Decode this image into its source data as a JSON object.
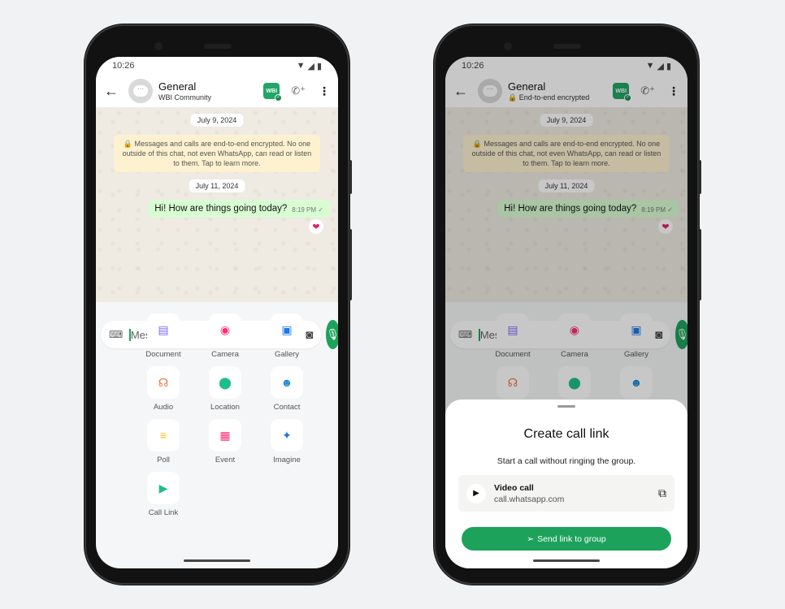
{
  "phones": [
    {
      "status_time": "10:26",
      "header": {
        "title": "General",
        "subtitle": "WBI Community",
        "badge": "WBI"
      },
      "chat": {
        "date1": "July 9, 2024",
        "encryption_note": "🔒 Messages and calls are end-to-end encrypted. No one outside of this chat, not even WhatsApp, can read or listen to them. Tap to learn more.",
        "date2": "July 11, 2024",
        "message": {
          "text": "Hi! How are things going today?",
          "time": "8:19 PM",
          "status": "✓",
          "reaction": "❤"
        }
      },
      "composer": {
        "placeholder": "Message"
      },
      "attachments": [
        {
          "label": "Document",
          "icon": "document-icon",
          "glyph": "▤",
          "color": "#7f66ff"
        },
        {
          "label": "Camera",
          "icon": "camera-icon",
          "glyph": "◉",
          "color": "#ff2e74"
        },
        {
          "label": "Gallery",
          "icon": "gallery-icon",
          "glyph": "▣",
          "color": "#1b79e5"
        },
        {
          "label": "Audio",
          "icon": "headphones-icon",
          "glyph": "☊",
          "color": "#f26f3c"
        },
        {
          "label": "Location",
          "icon": "location-icon",
          "glyph": "⬤",
          "color": "#1ebe8c"
        },
        {
          "label": "Contact",
          "icon": "contact-icon",
          "glyph": "☻",
          "color": "#1b8ad6"
        },
        {
          "label": "Poll",
          "icon": "poll-icon",
          "glyph": "≡",
          "color": "#ffbb15"
        },
        {
          "label": "Event",
          "icon": "event-icon",
          "glyph": "▦",
          "color": "#ff2e74"
        },
        {
          "label": "Imagine",
          "icon": "imagine-icon",
          "glyph": "✦",
          "color": "#1b79e5"
        },
        {
          "label": "Call Link",
          "icon": "call-link-icon",
          "glyph": "▶",
          "color": "#1ebe8c"
        }
      ]
    },
    {
      "status_time": "10:26",
      "header": {
        "title": "General",
        "subtitle": "🔒 End-to-end encrypted",
        "badge": "WBI"
      },
      "chat": {
        "date1": "July 9, 2024",
        "encryption_note": "🔒 Messages and calls are end-to-end encrypted. No one outside of this chat, not even WhatsApp, can read or listen to them. Tap to learn more.",
        "date2": "July 11, 2024",
        "message": {
          "text": "Hi! How are things going today?",
          "time": "8:19 PM",
          "status": "✓",
          "reaction": "❤"
        }
      },
      "composer": {
        "placeholder": "Message"
      },
      "attachments": [
        {
          "label": "Document",
          "icon": "document-icon",
          "glyph": "▤",
          "color": "#7f66ff"
        },
        {
          "label": "Camera",
          "icon": "camera-icon",
          "glyph": "◉",
          "color": "#ff2e74"
        },
        {
          "label": "Gallery",
          "icon": "gallery-icon",
          "glyph": "▣",
          "color": "#1b79e5"
        },
        {
          "label": "",
          "icon": "headphones-icon",
          "glyph": "☊",
          "color": "#f26f3c"
        },
        {
          "label": "",
          "icon": "location-icon",
          "glyph": "⬤",
          "color": "#1ebe8c"
        },
        {
          "label": "",
          "icon": "contact-icon",
          "glyph": "☻",
          "color": "#1b8ad6"
        }
      ],
      "sheet": {
        "title": "Create call link",
        "subtitle": "Start a call without ringing the group.",
        "card_title": "Video call",
        "card_url": "call.whatsapp.com",
        "send_label": "Send link to group"
      }
    }
  ],
  "colors": {
    "accent": "#1da25c",
    "bubble_out": "#d9fdd3",
    "encryption_bg": "#fdf1d0"
  }
}
